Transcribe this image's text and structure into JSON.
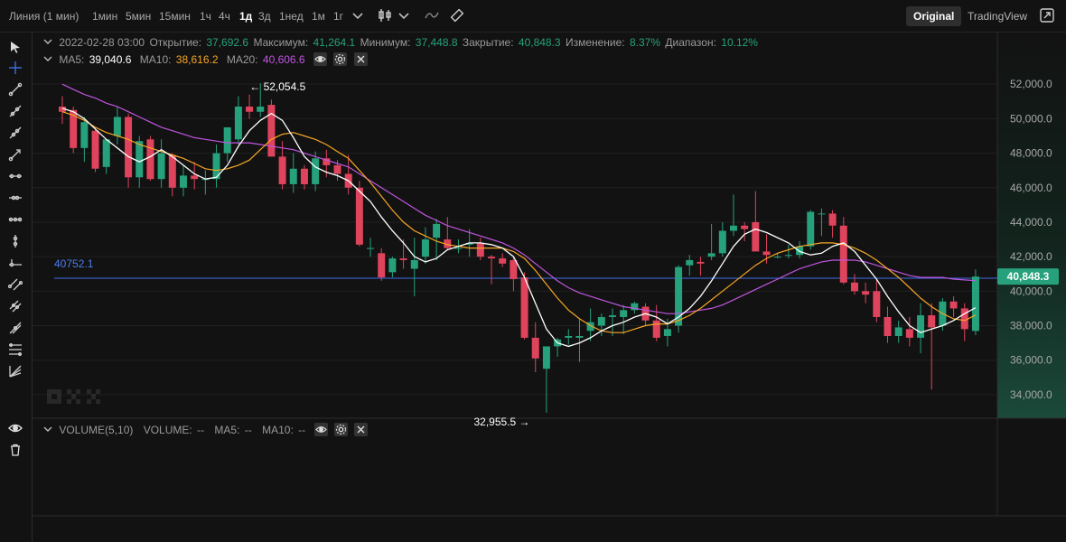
{
  "toolbar": {
    "timeframes": [
      "Линия (1 мин)",
      "1мин",
      "5мин",
      "15мин",
      "1ч",
      "4ч",
      "1д",
      "3д",
      "1нед",
      "1м",
      "1г"
    ],
    "active_timeframe": "1д",
    "mode_original": "Original",
    "mode_tradingview": "TradingView"
  },
  "legend": {
    "date": "2022-02-28 03:00",
    "open_label": "Открытие:",
    "open": "37,692.6",
    "high_label": "Максимум:",
    "high": "41,264.1",
    "low_label": "Минимум:",
    "low": "37,448.8",
    "close_label": "Закрытие:",
    "close": "40,848.3",
    "change_label": "Изменение:",
    "change": "8.37%",
    "range_label": "Диапазон:",
    "range": "10.12%"
  },
  "ma": {
    "ma5_label": "MA5:",
    "ma5": "39,040.6",
    "ma10_label": "MA10:",
    "ma10": "38,616.2",
    "ma20_label": "MA20:",
    "ma20": "40,606.6"
  },
  "volume_legend": {
    "volume_label": "VOLUME(5,10)",
    "vol_label": "VOLUME:",
    "vol": "--",
    "ma5_label": "MA5:",
    "ma5": "--",
    "ma10_label": "MA10:",
    "ma10": "--"
  },
  "colors": {
    "up": "#26a17b",
    "down": "#e0435c",
    "ma5": "#ffffff",
    "ma10": "#f5a623",
    "ma20": "#c055e0",
    "hline": "#3f6ee8",
    "price_tag": "#26a17b"
  },
  "chart_data": {
    "type": "candlestick",
    "ylim": [
      33000,
      52900
    ],
    "y_ticks": [
      34000,
      36000,
      38000,
      40000,
      42000,
      44000,
      46000,
      48000,
      50000,
      52000
    ],
    "y_tick_labels": [
      "34,000.0",
      "36,000.0",
      "38,000.0",
      "40,000.0",
      "42,000.0",
      "44,000.0",
      "46,000.0",
      "48,000.0",
      "50,000.0",
      "52,000.0"
    ],
    "current_price": 40848.3,
    "current_price_label": "40,848.3",
    "hline_value": 40752.1,
    "hline_label": "40752.1",
    "high_marker": {
      "index": 18,
      "value": 52054.5,
      "label": "52,054.5"
    },
    "low_marker": {
      "index": 42,
      "value": 32955.5,
      "label": "32,955.5"
    },
    "candles": [
      [
        50700,
        51300,
        49700,
        50400
      ],
      [
        50500,
        50700,
        48000,
        48300
      ],
      [
        48300,
        50100,
        47500,
        49800
      ],
      [
        49300,
        49500,
        46900,
        47100
      ],
      [
        47200,
        48800,
        46800,
        48800
      ],
      [
        49000,
        50700,
        48500,
        50100
      ],
      [
        50100,
        50300,
        46000,
        46600
      ],
      [
        46600,
        49000,
        46000,
        48700
      ],
      [
        48800,
        49000,
        46400,
        46500
      ],
      [
        46500,
        48800,
        46000,
        48000
      ],
      [
        47900,
        48000,
        45500,
        46000
      ],
      [
        46000,
        47300,
        45500,
        46700
      ],
      [
        46700,
        47500,
        45900,
        46500
      ],
      [
        46500,
        47000,
        45600,
        46500
      ],
      [
        46500,
        48500,
        46000,
        48000
      ],
      [
        48000,
        49500,
        47500,
        49500
      ],
      [
        48800,
        51300,
        48500,
        50700
      ],
      [
        50700,
        51400,
        50000,
        50400
      ],
      [
        50400,
        52054.5,
        50100,
        50700
      ],
      [
        50800,
        51100,
        47800,
        47800
      ],
      [
        47800,
        48700,
        45900,
        46200
      ],
      [
        46200,
        48000,
        45700,
        47100
      ],
      [
        47100,
        47300,
        45900,
        46200
      ],
      [
        46200,
        48100,
        45800,
        47700
      ],
      [
        47700,
        48200,
        46600,
        47300
      ],
      [
        47300,
        47600,
        46400,
        46800
      ],
      [
        46800,
        47900,
        45600,
        46000
      ],
      [
        46000,
        46400,
        42600,
        42700
      ],
      [
        42500,
        43100,
        42000,
        42500
      ],
      [
        42200,
        42500,
        40600,
        40800
      ],
      [
        41100,
        42000,
        40800,
        41900
      ],
      [
        41900,
        43000,
        41300,
        41800
      ],
      [
        41300,
        43100,
        39700,
        41800
      ],
      [
        42000,
        43700,
        41600,
        43000
      ],
      [
        43100,
        44200,
        41800,
        43900
      ],
      [
        43000,
        44300,
        42400,
        42500
      ],
      [
        42500,
        43000,
        42200,
        42500
      ],
      [
        42700,
        43600,
        42000,
        42800
      ],
      [
        42800,
        43100,
        41800,
        42000
      ],
      [
        42000,
        42100,
        40400,
        41900
      ],
      [
        41900,
        42200,
        41400,
        41600
      ],
      [
        41800,
        42000,
        40000,
        40700
      ],
      [
        40800,
        41100,
        37200,
        37300
      ],
      [
        37300,
        38200,
        35300,
        36100
      ],
      [
        35500,
        36300,
        32955.5,
        36800
      ],
      [
        36800,
        37300,
        36200,
        37200
      ],
      [
        37300,
        37800,
        36900,
        37400
      ],
      [
        37300,
        38400,
        35900,
        37400
      ],
      [
        37700,
        39000,
        37100,
        38200
      ],
      [
        38000,
        38700,
        37400,
        38500
      ],
      [
        38500,
        39000,
        37400,
        38600
      ],
      [
        38500,
        39200,
        37500,
        38900
      ],
      [
        38900,
        39400,
        38700,
        39300
      ],
      [
        39100,
        39300,
        38000,
        38300
      ],
      [
        38300,
        39200,
        37100,
        37300
      ],
      [
        37400,
        38400,
        36800,
        37800
      ],
      [
        38000,
        41500,
        37600,
        41400
      ],
      [
        41500,
        42100,
        40900,
        41800
      ],
      [
        41700,
        42000,
        40900,
        41600
      ],
      [
        42000,
        43900,
        41800,
        42200
      ],
      [
        42200,
        44000,
        42000,
        43500
      ],
      [
        43500,
        45600,
        43200,
        43800
      ],
      [
        43800,
        44000,
        42900,
        43600
      ],
      [
        44000,
        45800,
        43300,
        42300
      ],
      [
        42300,
        43300,
        41600,
        42100
      ],
      [
        42000,
        42200,
        41900,
        42000
      ],
      [
        42100,
        42700,
        41900,
        42100
      ],
      [
        42100,
        42900,
        41900,
        42600
      ],
      [
        42600,
        44700,
        42400,
        44600
      ],
      [
        44500,
        44800,
        43200,
        44500
      ],
      [
        44500,
        44700,
        43100,
        43800
      ],
      [
        43800,
        44300,
        40400,
        40500
      ],
      [
        40500,
        41000,
        39800,
        40000
      ],
      [
        40000,
        40500,
        39300,
        39800
      ],
      [
        40000,
        40700,
        38200,
        38500
      ],
      [
        38500,
        39100,
        37000,
        37400
      ],
      [
        37400,
        38300,
        37000,
        37900
      ],
      [
        37800,
        38500,
        36800,
        37300
      ],
      [
        37300,
        39300,
        36400,
        38600
      ],
      [
        38600,
        39300,
        34300,
        37900
      ],
      [
        38000,
        39600,
        37700,
        39400
      ],
      [
        39400,
        39700,
        38500,
        39000
      ],
      [
        39000,
        39300,
        37100,
        37800
      ],
      [
        37692.6,
        41264.1,
        37448.8,
        40848.3
      ]
    ],
    "ma5": [
      50600,
      50400,
      50000,
      49400,
      48800,
      48300,
      47800,
      47500,
      47800,
      48200,
      47800,
      47300,
      46800,
      46500,
      46600,
      47300,
      48400,
      49300,
      49900,
      50300,
      49900,
      48900,
      47800,
      47200,
      46900,
      46700,
      46400,
      45800,
      45200,
      44300,
      43500,
      42800,
      42000,
      41700,
      41900,
      42400,
      42600,
      42800,
      42800,
      42700,
      42500,
      42000,
      40800,
      39300,
      37800,
      37000,
      36800,
      37000,
      37300,
      37700,
      38000,
      38200,
      38500,
      38700,
      38500,
      38100,
      38500,
      39000,
      39700,
      40600,
      41600,
      42600,
      43300,
      43600,
      43400,
      43100,
      42800,
      42300,
      42100,
      42200,
      42600,
      42800,
      42300,
      41500,
      40700,
      39700,
      38800,
      38000,
      37600,
      37800,
      38000,
      38300,
      38700,
      39040.6
    ],
    "ma10": [
      50400,
      50200,
      49900,
      49500,
      49200,
      49000,
      48800,
      48500,
      48300,
      48100,
      47900,
      47700,
      47400,
      47100,
      47000,
      47100,
      47300,
      47600,
      48200,
      48800,
      49100,
      49200,
      49000,
      48800,
      48500,
      48100,
      47700,
      47000,
      46300,
      45500,
      44700,
      44000,
      43500,
      43200,
      42900,
      42700,
      42600,
      42500,
      42500,
      42500,
      42500,
      42300,
      41900,
      41200,
      40400,
      39600,
      38900,
      38400,
      38000,
      37700,
      37600,
      37600,
      37800,
      38000,
      38100,
      38100,
      38300,
      38600,
      39000,
      39500,
      40000,
      40500,
      41000,
      41500,
      41900,
      42200,
      42400,
      42600,
      42700,
      42800,
      42800,
      42700,
      42500,
      42200,
      41800,
      41300,
      40800,
      40200,
      39600,
      39100,
      38700,
      38400,
      38300,
      38616.2
    ],
    "ma20": [
      52000,
      51700,
      51400,
      51200,
      50900,
      50700,
      50400,
      50100,
      49800,
      49500,
      49300,
      49100,
      48900,
      48800,
      48700,
      48600,
      48600,
      48600,
      48500,
      48400,
      48300,
      48200,
      48000,
      47800,
      47600,
      47400,
      47200,
      46800,
      46400,
      46000,
      45600,
      45200,
      44800,
      44400,
      44100,
      43800,
      43600,
      43400,
      43200,
      43000,
      42800,
      42500,
      42100,
      41600,
      41100,
      40600,
      40200,
      39900,
      39700,
      39500,
      39300,
      39100,
      39000,
      38900,
      38800,
      38700,
      38700,
      38800,
      38900,
      39000,
      39200,
      39500,
      39800,
      40100,
      40400,
      40700,
      41000,
      41300,
      41500,
      41700,
      41800,
      41800,
      41800,
      41700,
      41500,
      41300,
      41100,
      40900,
      40800,
      40800,
      40800,
      40700,
      40650,
      40606.6
    ]
  }
}
